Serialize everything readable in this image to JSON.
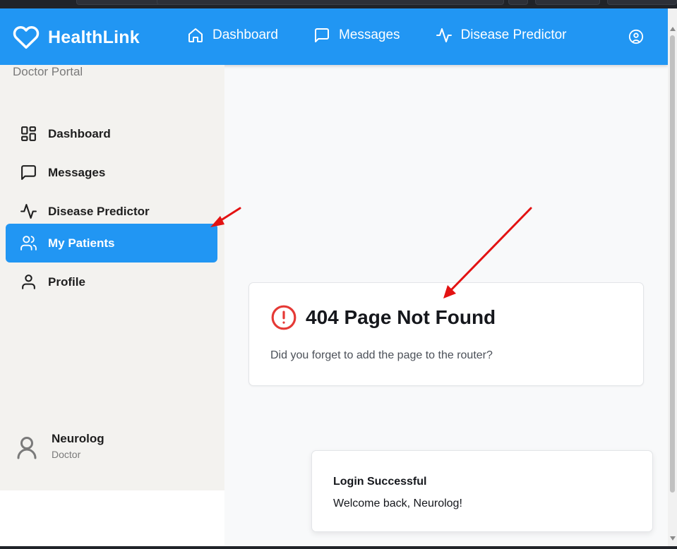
{
  "header": {
    "brand": "HealthLink",
    "nav": [
      {
        "label": "Dashboard",
        "icon": "home-icon"
      },
      {
        "label": "Messages",
        "icon": "message-icon"
      },
      {
        "label": "Disease Predictor",
        "icon": "activity-icon"
      }
    ],
    "user_icon": "user-circle-icon"
  },
  "sidebar": {
    "portal_label": "Doctor Portal",
    "items": [
      {
        "label": "Dashboard",
        "icon": "layout-grid-icon",
        "active": false
      },
      {
        "label": "Messages",
        "icon": "message-icon",
        "active": false
      },
      {
        "label": "Disease Predictor",
        "icon": "activity-icon",
        "active": false
      },
      {
        "label": "My Patients",
        "icon": "users-icon",
        "active": true
      },
      {
        "label": "Profile",
        "icon": "user-icon",
        "active": false
      }
    ],
    "user": {
      "name": "Neurolog",
      "role": "Doctor"
    }
  },
  "main": {
    "error_title": "404 Page Not Found",
    "error_message": "Did you forget to add the page to the router?"
  },
  "toast": {
    "title": "Login Successful",
    "message": "Welcome back, Neurolog!"
  },
  "colors": {
    "primary": "#2196f3",
    "error": "#e53935",
    "annotation_arrow": "#e31212",
    "sidebar_bg": "#f3f2ef",
    "main_bg": "#f8f9fa"
  }
}
